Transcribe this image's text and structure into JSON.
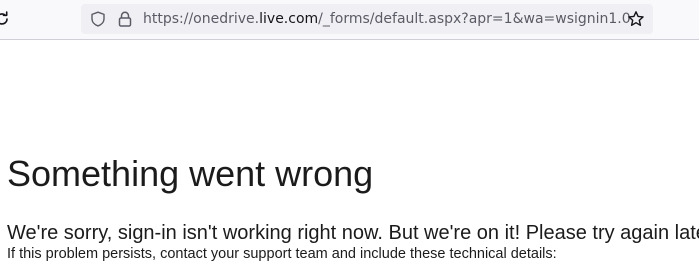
{
  "browser": {
    "url_prefix": "https://onedrive.",
    "url_domain": "live.com",
    "url_path": "/_forms/default.aspx?apr=1&wa=wsignin1.0",
    "icons": [
      "reload-icon",
      "shield-icon",
      "lock-icon",
      "bookmark-star-icon"
    ]
  },
  "page": {
    "heading": "Something went wrong",
    "message": "We're sorry, sign-in isn't working right now. But we're on it! Please try again later.",
    "details_intro": "If this problem persists, contact your support team and include these technical details:"
  }
}
